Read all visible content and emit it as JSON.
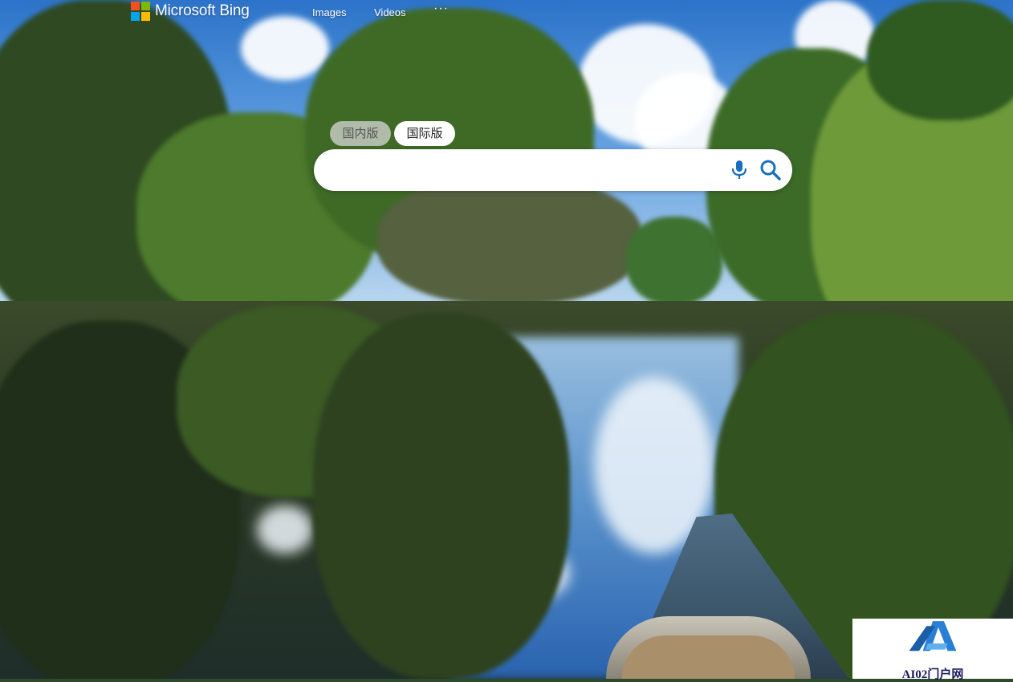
{
  "header": {
    "brand": "Microsoft Bing",
    "nav": [
      {
        "label": "Images"
      },
      {
        "label": "Videos"
      }
    ],
    "more": "···"
  },
  "logo_colors": [
    "#f25022",
    "#7fba00",
    "#00a4ef",
    "#ffb900"
  ],
  "region_toggle": {
    "domestic_label": "国内版",
    "international_label": "国际版",
    "active": "international"
  },
  "search": {
    "value": "",
    "placeholder": "",
    "mic_icon": "microphone-icon",
    "search_icon": "magnifier-icon",
    "icon_color": "#1a6fbf"
  },
  "watermark": {
    "text": "AI02门户网",
    "logo_color": "#2a7fd4"
  }
}
